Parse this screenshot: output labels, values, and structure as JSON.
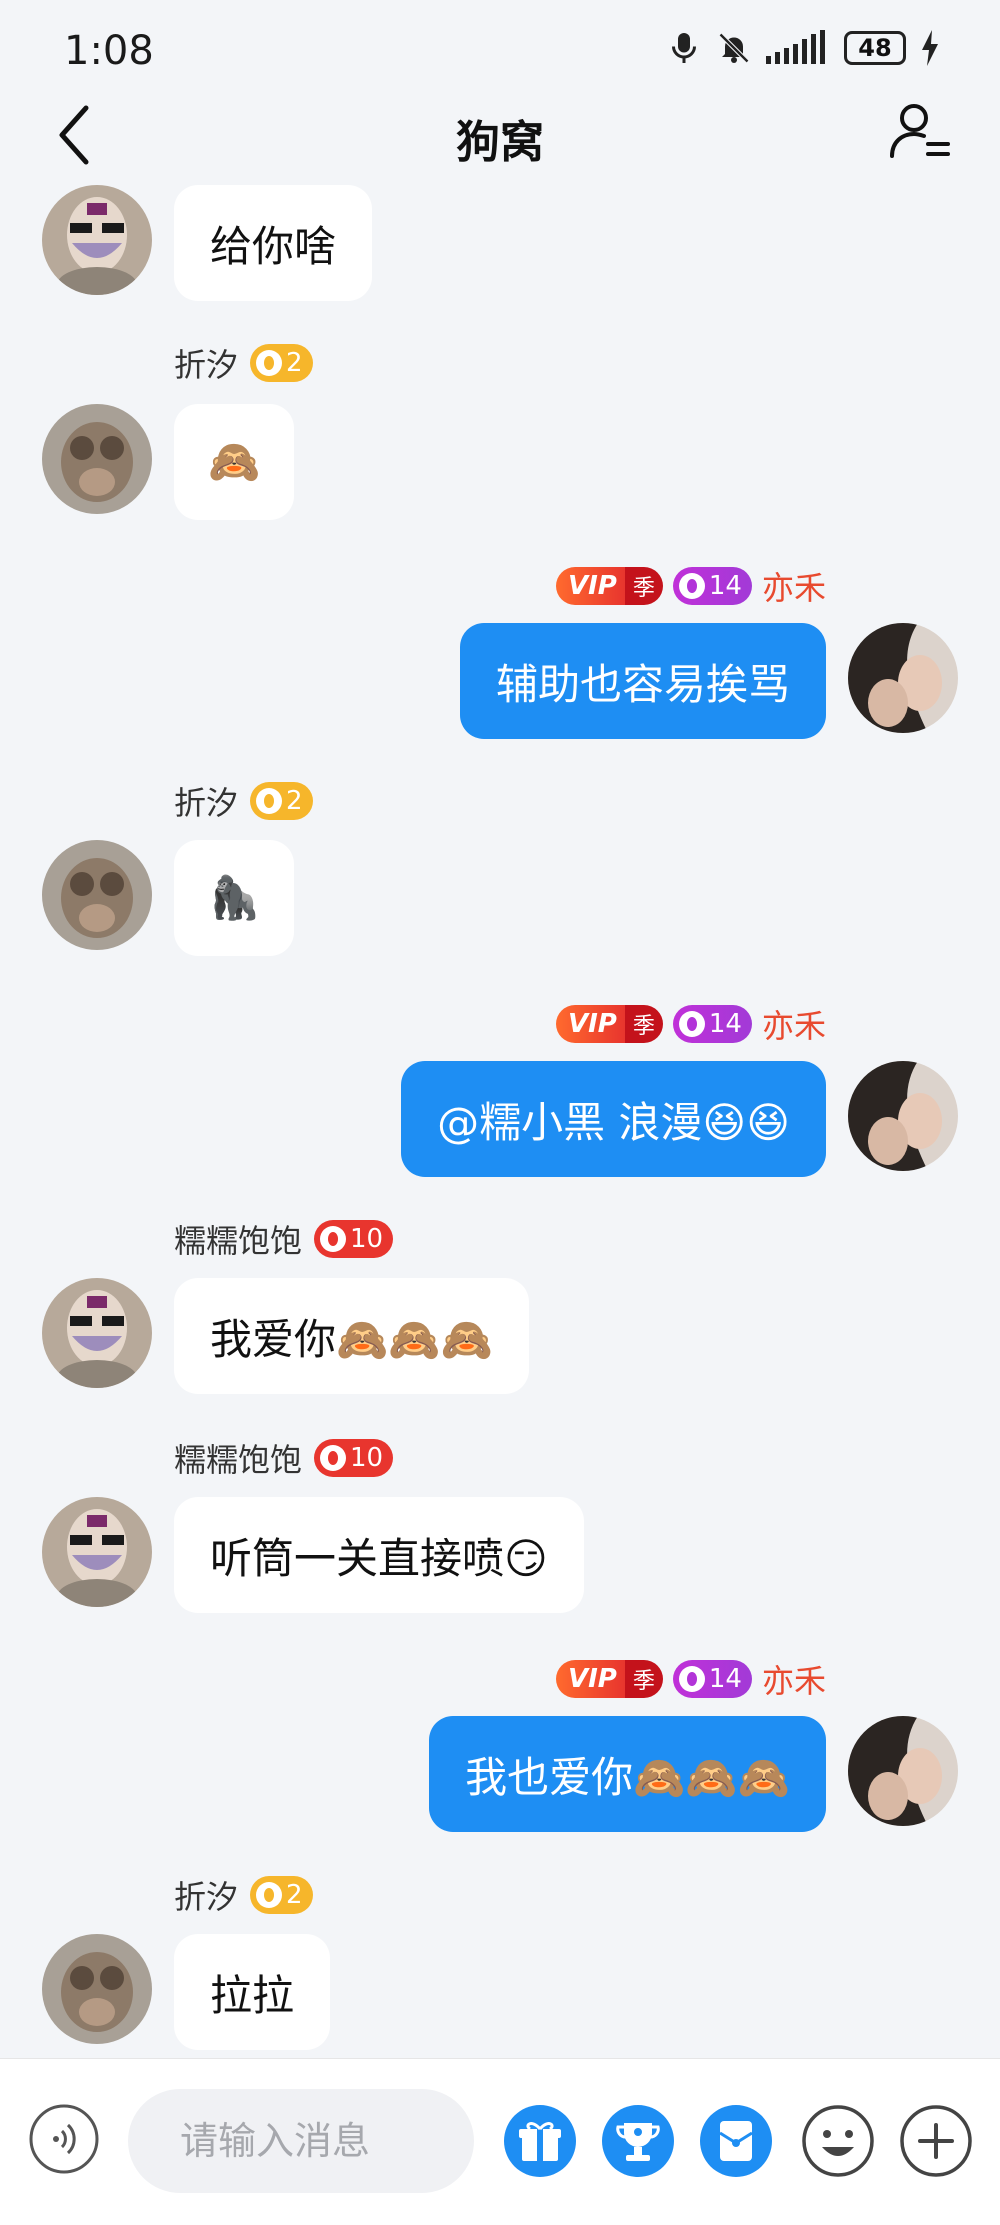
{
  "status": {
    "time": "1:08",
    "battery": "48"
  },
  "header": {
    "title": "狗窝"
  },
  "messages": [
    {
      "side": "left",
      "text": "给你啥"
    },
    {
      "side": "left",
      "name": "折汐",
      "level": "2",
      "text": "🙈"
    },
    {
      "side": "right",
      "name": "亦禾",
      "vip": "VIP",
      "vip_tag": "季",
      "level": "14",
      "text": "辅助也容易挨骂"
    },
    {
      "side": "left",
      "name": "折汐",
      "level": "2",
      "text": "🦍"
    },
    {
      "side": "right",
      "name": "亦禾",
      "vip": "VIP",
      "vip_tag": "季",
      "level": "14",
      "text": "@糯小黑 浪漫😆😆"
    },
    {
      "side": "left",
      "name": "糯糯饱饱",
      "level": "10",
      "text": "我爱你🙈🙈🙈"
    },
    {
      "side": "left",
      "name": "糯糯饱饱",
      "level": "10",
      "text": "听筒一关直接喷😏"
    },
    {
      "side": "right",
      "name": "亦禾",
      "vip": "VIP",
      "vip_tag": "季",
      "level": "14",
      "text": "我也爱你🙈🙈🙈"
    },
    {
      "side": "left",
      "name": "折汐",
      "level": "2",
      "text": "拉拉"
    }
  ],
  "input": {
    "placeholder": "请输入消息"
  },
  "icons": {
    "voice": "voice-icon",
    "gift": "gift-icon",
    "trophy": "trophy-icon",
    "red_packet": "red-packet-icon",
    "emoji": "emoji-icon",
    "plus": "plus-icon"
  },
  "colors": {
    "bubble_mine": "#1e8ef3",
    "accent": "#1e8ef3",
    "name_mine": "#e84a2f"
  }
}
